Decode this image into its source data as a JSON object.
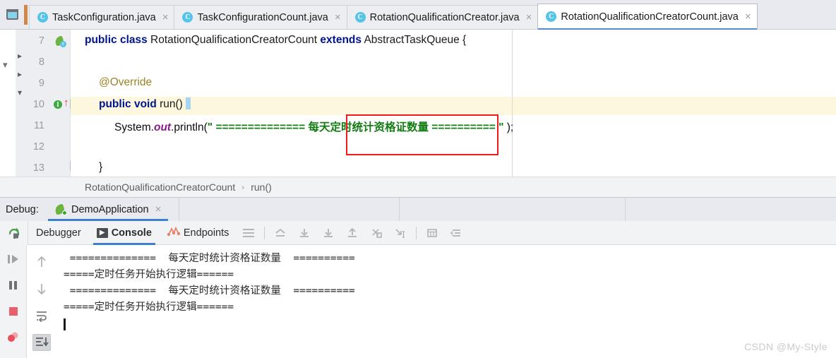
{
  "window": {
    "left_icon": "project-window-icon"
  },
  "tabs": [
    {
      "label": "TaskConfiguration.java",
      "icon": "java-class-icon",
      "active": false
    },
    {
      "label": "TaskConfigurationCount.java",
      "icon": "java-class-icon",
      "active": false
    },
    {
      "label": "RotationQualificationCreator.java",
      "icon": "java-class-icon",
      "active": false
    },
    {
      "label": "RotationQualificationCreatorCount.java",
      "icon": "java-class-icon",
      "active": true
    }
  ],
  "tab_close_glyph": "×",
  "editor": {
    "line_numbers": [
      "7",
      "8",
      "9",
      "10",
      "11",
      "12",
      "13"
    ],
    "gutter_markers": {
      "line7": "spring-bean-icon",
      "line10": "implementing-method-icon"
    },
    "lines": {
      "l7_kw1": "public class",
      "l7_name": " RotationQualificationCreatorCount ",
      "l7_kw2": "extends",
      "l7_super": " AbstractTaskQueue {",
      "l9_annotation": "@Override",
      "l10_kw": "public void",
      "l10_sig": " run() ",
      "l10_brace": "{",
      "l11_prefix": "System.",
      "l11_field": "out",
      "l11_method": ".println(",
      "l11_quote_open": "\" ",
      "l11_eq_left": "============== ",
      "l11_chinese": "每天定时统计资格证数量",
      "l11_eq_right": " ==========",
      "l11_quote_close": " \"",
      "l11_suffix": " );",
      "l13_brace": "}"
    },
    "highlight_annotation": "red-rectangle-highlight"
  },
  "breadcrumb": {
    "class": "RotationQualificationCreatorCount",
    "separator": "›",
    "method": "run()"
  },
  "debug_header": {
    "label": "Debug:",
    "session": "DemoApplication",
    "session_icon": "spring-boot-run-icon",
    "close_glyph": "×"
  },
  "debug_toolbar": {
    "rerun_icon": "rerun-icon",
    "tabs": [
      {
        "label": "Debugger",
        "icon": null,
        "active": false
      },
      {
        "label": "Console",
        "icon": "console-icon",
        "active": true
      },
      {
        "label": "Endpoints",
        "icon": "endpoints-icon",
        "active": false
      }
    ],
    "layout_icon": "layout-settings-icon",
    "step_icons": [
      "show-execution-point-icon",
      "step-over-icon",
      "step-into-icon",
      "step-out-icon",
      "force-step-into-icon",
      "run-to-cursor-icon"
    ],
    "extra_icons": [
      "evaluate-expression-icon",
      "trace-settings-icon"
    ]
  },
  "debug_rails": {
    "left": [
      "resume-program-icon",
      "pause-program-icon",
      "stop-program-icon",
      "view-breakpoints-icon"
    ],
    "right": [
      "scroll-up-icon",
      "scroll-down-icon",
      "soft-wrap-icon",
      "scroll-to-end-icon"
    ]
  },
  "console": {
    "lines": [
      " ==============  每天定时统计资格证数量  ==========",
      "=====定时任务开始执行逻辑======",
      " ==============  每天定时统计资格证数量  ==========",
      "=====定时任务开始执行逻辑======"
    ]
  },
  "watermark": "CSDN @My-Style",
  "colors": {
    "accent": "#3d7fd0",
    "string_green": "#127d12",
    "keyword_blue": "#00148c",
    "annotation_yellow": "#9b8225",
    "highlight_red": "#f01b1b",
    "row_highlight": "#fdf7dd",
    "chrome": "#e8eaef"
  }
}
